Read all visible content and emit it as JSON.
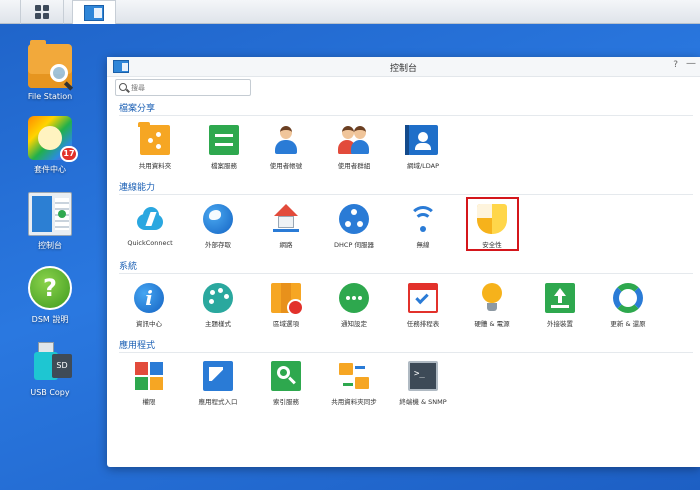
{
  "taskbar": {
    "main_menu_icon": "grid-icon",
    "active_app_icon": "control-panel-icon"
  },
  "desktop": {
    "icons": [
      {
        "label": "File Station",
        "icon": "file-station-icon"
      },
      {
        "label": "套件中心",
        "icon": "package-center-icon",
        "badge": "17"
      },
      {
        "label": "控制台",
        "icon": "control-panel-icon"
      },
      {
        "label": "DSM 說明",
        "icon": "help-icon"
      },
      {
        "label": "USB Copy",
        "icon": "usb-copy-icon",
        "sd_label": "SD"
      }
    ]
  },
  "window": {
    "title": "控制台",
    "help_glyph": "?",
    "minimize_glyph": "—",
    "search": {
      "placeholder": "搜尋"
    },
    "sections": [
      {
        "title": "檔案分享",
        "items": [
          {
            "label": "共用資料夾",
            "icon": "shared-folder-icon"
          },
          {
            "label": "檔案服務",
            "icon": "file-services-icon"
          },
          {
            "label": "使用者帳號",
            "icon": "user-icon"
          },
          {
            "label": "使用者群組",
            "icon": "group-icon"
          },
          {
            "label": "網域/LDAP",
            "icon": "ldap-icon"
          }
        ]
      },
      {
        "title": "連線能力",
        "items": [
          {
            "label": "QuickConnect",
            "icon": "quickconnect-icon"
          },
          {
            "label": "外部存取",
            "icon": "external-access-icon"
          },
          {
            "label": "網路",
            "icon": "network-icon"
          },
          {
            "label": "DHCP 伺服器",
            "icon": "dhcp-server-icon"
          },
          {
            "label": "無線",
            "icon": "wireless-icon"
          },
          {
            "label": "安全性",
            "icon": "security-shield-icon",
            "highlighted": true
          }
        ]
      },
      {
        "title": "系統",
        "items": [
          {
            "label": "資訊中心",
            "icon": "info-center-icon"
          },
          {
            "label": "主題樣式",
            "icon": "theme-palette-icon"
          },
          {
            "label": "區域選項",
            "icon": "regional-options-icon"
          },
          {
            "label": "通知設定",
            "icon": "notification-icon"
          },
          {
            "label": "任務排程表",
            "icon": "task-scheduler-icon"
          },
          {
            "label": "硬體 & 電源",
            "icon": "hardware-power-icon"
          },
          {
            "label": "外接裝置",
            "icon": "external-devices-icon"
          },
          {
            "label": "更新 & 還原",
            "icon": "update-restore-icon"
          }
        ]
      },
      {
        "title": "應用程式",
        "items": [
          {
            "label": "權限",
            "icon": "privileges-icon"
          },
          {
            "label": "應用程式入口",
            "icon": "application-portal-icon"
          },
          {
            "label": "索引服務",
            "icon": "indexing-service-icon"
          },
          {
            "label": "共用資料夾同步",
            "icon": "shared-folder-sync-icon"
          },
          {
            "label": "終端機 & SNMP",
            "icon": "terminal-snmp-icon"
          }
        ]
      }
    ]
  },
  "colors": {
    "desktop_bg": "#2a78e0",
    "section_title": "#1a5fb4",
    "highlight_border": "#d4161b"
  }
}
